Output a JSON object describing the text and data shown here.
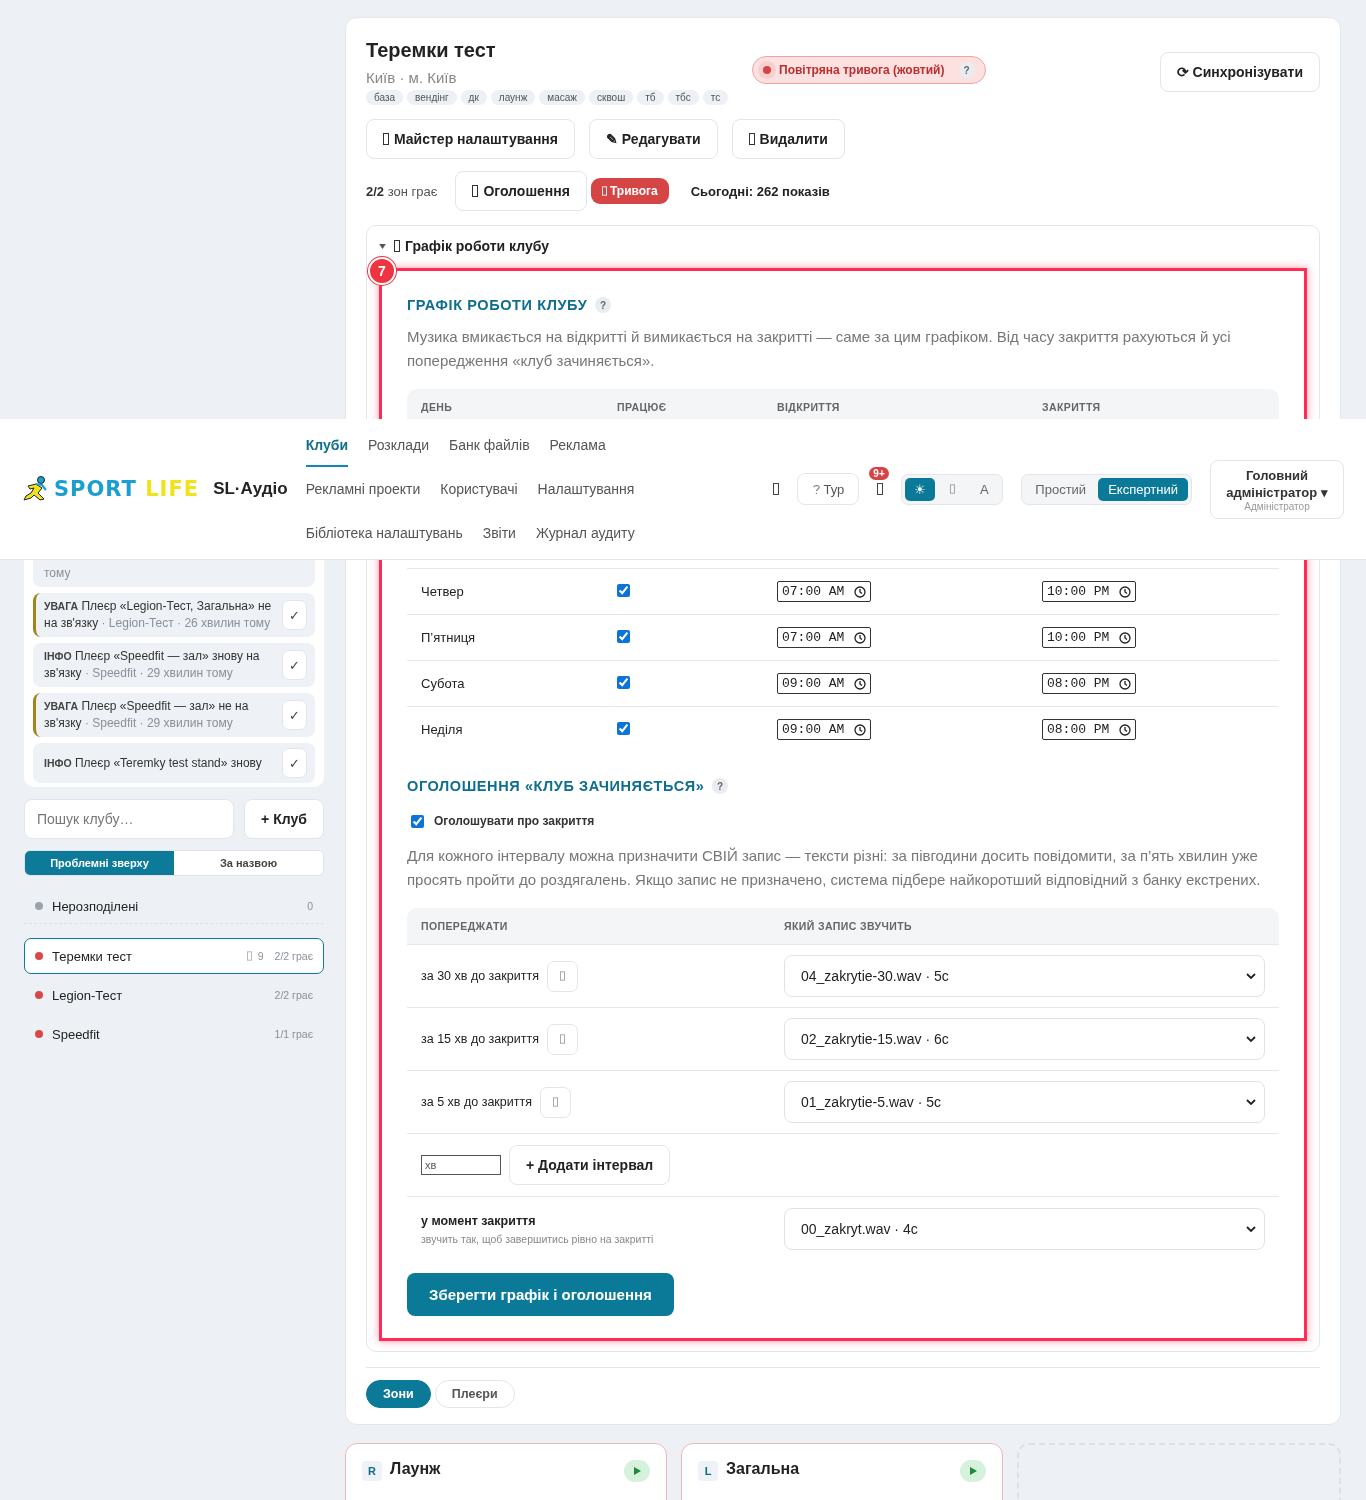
{
  "header": {
    "logo": {
      "word_1": "SPORT",
      "word_2": "LIFE"
    },
    "app_name": "SL·Аудіо",
    "nav": [
      {
        "label": "Клуби",
        "selected": true
      },
      {
        "label": "Розклади",
        "selected": false
      },
      {
        "label": "Банк файлів",
        "selected": false
      },
      {
        "label": "Реклама",
        "selected": false
      },
      {
        "label": "Рекламні проекти",
        "selected": false
      },
      {
        "label": "Користувачі",
        "selected": false
      },
      {
        "label": "Налаштування",
        "selected": false
      },
      {
        "label": "Бібліотека налаштувань",
        "selected": false
      },
      {
        "label": "Звіти",
        "selected": false
      },
      {
        "label": "Журнал аудиту",
        "selected": false
      }
    ],
    "tour_button": "Тур",
    "notifications_badge": "9+",
    "theme_options": [
      {
        "kind": "light",
        "label": "☀",
        "selected": true
      },
      {
        "kind": "dark",
        "selected": false
      },
      {
        "kind": "auto",
        "label": "A",
        "selected": false
      }
    ],
    "mode_options": [
      {
        "label": "Простий",
        "selected": false
      },
      {
        "label": "Експертний",
        "selected": true
      }
    ],
    "user": {
      "name": "Головний адміністратор",
      "caret": "▾",
      "role": "Адміністратор"
    }
  },
  "sidebar": {
    "alerts": [
      {
        "kind": "info",
        "meta": "тому"
      },
      {
        "kind": "warning",
        "label": "УВАГА",
        "text": "Плеєр «Legion-Тест, Загальна» не на зв'язку",
        "meta": "· Legion-Тест · 26 хвилин тому",
        "ack": "✓"
      },
      {
        "kind": "info",
        "label": "ІНФО",
        "text": "Плеєр «Speedfit — зал» знову на зв'язку",
        "meta": "· Speedfit · 29 хвилин тому",
        "ack": "✓"
      },
      {
        "kind": "warning",
        "label": "УВАГА",
        "text": "Плеєр «Speedfit — зал» не на зв'язку",
        "meta": "· Speedfit · 29 хвилин тому",
        "ack": "✓"
      },
      {
        "kind": "info",
        "label": "ІНФО",
        "text": "Плеєр «Teremky test stand» знову",
        "ack": "✓"
      }
    ],
    "search": {
      "placeholder": "Пошук клубу…"
    },
    "add_button": "+ Клуб",
    "sort_options": [
      {
        "label": "Проблемні зверху",
        "selected": true
      },
      {
        "label": "За назвою",
        "selected": false
      }
    ],
    "clubs": [
      {
        "name": "Нерозподілені",
        "color": "#9aa3ad",
        "status": "0",
        "selected": false
      },
      {
        "name": "Теремки тест",
        "color": "#d94848",
        "count": "9",
        "status": "2/2 грає",
        "selected": true
      },
      {
        "name": "Legion-Тест",
        "color": "#d94848",
        "status": "2/2 грає",
        "selected": false
      },
      {
        "name": "Speedfit",
        "color": "#d94848",
        "status": "1/1 грає",
        "selected": false
      }
    ]
  },
  "club": {
    "title": "Теремки тест",
    "location": "Київ · м. Київ",
    "tags": [
      "база",
      "вендінг",
      "дк",
      "лаунж",
      "масаж",
      "сквош",
      "тб",
      "тбс",
      "тс"
    ],
    "alert": {
      "text": "Повітряна тривога (жовтий)",
      "help": "?"
    },
    "sync_button": "⟳ Синхронізувати",
    "actions": [
      {
        "label": "Майстер налаштування",
        "glyph": true
      },
      {
        "label": "✎ Редагувати",
        "glyph": false
      },
      {
        "label": "Видалити",
        "glyph": true
      }
    ],
    "status": {
      "zones": "2/2",
      "zones_text": "зон грає",
      "announce_button": "Оголошення",
      "alarm_badge": "Тривога",
      "today": "Сьогодні: 262 показів"
    }
  },
  "schedule": {
    "summary": "Графік роботи клубу",
    "expanded": true,
    "marker": "7",
    "heading": "ГРАФІК РОБОТИ КЛУБУ",
    "help": "?",
    "description": "Музика вмикається на відкритті й вимикається на закритті — саме за цим графіком. Від часу закриття рахуються й усі попередження «клуб зачиняється».",
    "columns": [
      "ДЕНЬ",
      "ПРАЦЮЄ",
      "ВІДКРИТТЯ",
      "ЗАКРИТТЯ"
    ],
    "rows": [
      {
        "day": "Четвер",
        "works": true,
        "open": "07:00 AM",
        "close": "10:00 PM"
      },
      {
        "day": "П’ятниця",
        "works": true,
        "open": "07:00 AM",
        "close": "10:00 PM"
      },
      {
        "day": "Субота",
        "works": true,
        "open": "09:00 AM",
        "close": "08:00 PM"
      },
      {
        "day": "Неділя",
        "works": true,
        "open": "09:00 AM",
        "close": "08:00 PM"
      }
    ]
  },
  "announcements": {
    "heading": "ОГОЛОШЕННЯ «КЛУБ ЗАЧИНЯЄТЬСЯ»",
    "help": "?",
    "enabled": true,
    "enabled_label": "Оголошувати про закриття",
    "description": "Для кожного інтервалу можна призначити СВІЙ запис — тексти різні: за півгодини досить повідомити, за п’ять хвилин уже просять пройти до роздягалень. Якщо запис не призначено, система підбере найкоротший відповідний з банку екстрених.",
    "columns": [
      "ПОПЕРЕДЖАТИ",
      "ЯКИЙ ЗАПИС ЗВУЧИТЬ"
    ],
    "intervals": [
      {
        "label": "за 30 хв до закриття",
        "file": "04_zakrytie-30.wav · 5с"
      },
      {
        "label": "за 15 хв до закриття",
        "file": "02_zakrytie-15.wav · 6с"
      },
      {
        "label": "за 5 хв до закриття",
        "file": "01_zakrytie-5.wav · 5с"
      }
    ],
    "minutes": {
      "placeholder": "хв"
    },
    "add_button": "+ Додати інтервал",
    "closing": {
      "label": "у момент закриття",
      "hint": "звучить так, щоб завершитись рівно на закритті",
      "file": "00_zakryt.wav · 4с"
    },
    "save_button": "Зберегти графік і оголошення"
  },
  "view_tabs": [
    {
      "label": "Зони",
      "selected": true
    },
    {
      "label": "Плеєри",
      "selected": false
    }
  ],
  "zones": [
    {
      "badge": "R",
      "name": "Лаунж"
    },
    {
      "badge": "L",
      "name": "Загальна"
    }
  ]
}
